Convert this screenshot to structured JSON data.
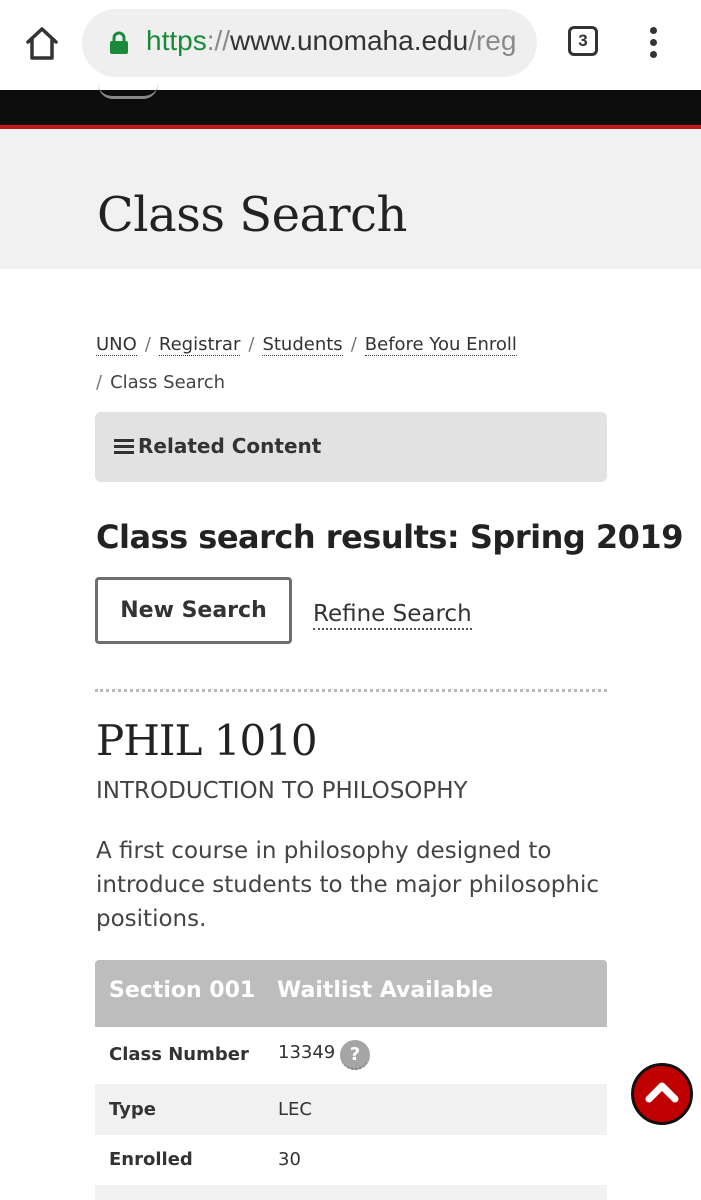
{
  "browser": {
    "url_scheme": "https",
    "url_separator": "://",
    "url_host": "www.unomaha.edu",
    "url_path": "/reg",
    "tab_count": "3",
    "icons": [
      "home-icon",
      "lock-icon",
      "tabs-icon",
      "more-vert-icon"
    ],
    "colors": {
      "secure": "#1a8a3a"
    }
  },
  "header": {
    "page_title": "Class Search"
  },
  "breadcrumb": {
    "items": [
      "UNO",
      "Registrar",
      "Students",
      "Before You Enroll"
    ],
    "current": "Class Search",
    "separator": "/"
  },
  "related": {
    "label": "Related Content",
    "icon": "menu-icon"
  },
  "results": {
    "heading": "Class search results: Spring 2019",
    "new_search_label": "New Search",
    "refine_search_label": "Refine Search"
  },
  "course": {
    "code": "PHIL 1010",
    "title": "INTRODUCTION TO PHILOSOPHY",
    "description": "A first course in philosophy designed to introduce students to the major philosophic positions."
  },
  "section": {
    "name": "Section 001",
    "status": "Waitlist Available",
    "rows": [
      {
        "label": "Class Number",
        "value": "13349",
        "help": "?"
      },
      {
        "label": "Type",
        "value": "LEC"
      },
      {
        "label": "Enrolled",
        "value": "30"
      }
    ]
  },
  "colors": {
    "accent_red": "#c4161c",
    "to_top_button": "#c00000"
  }
}
